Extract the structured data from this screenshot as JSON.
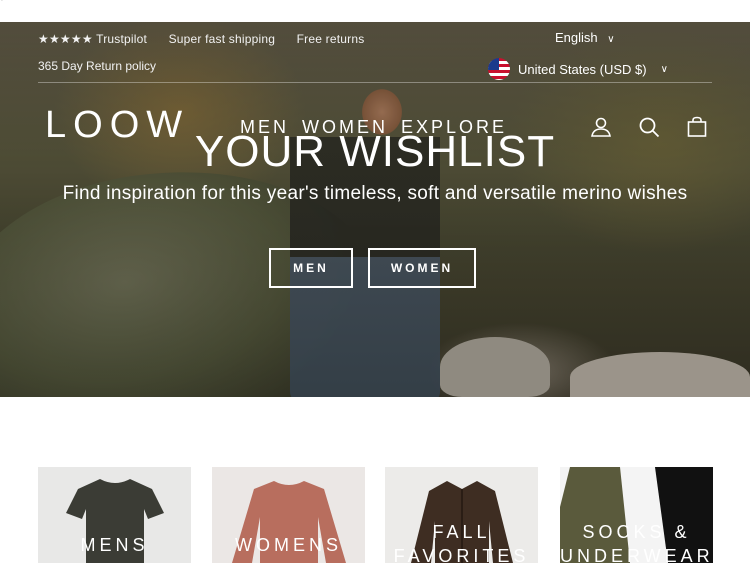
{
  "stray_mark": "'",
  "announcement": {
    "rating": "★★★★★ Trustpilot",
    "shipping": "Super fast shipping",
    "returns": "Free returns",
    "return_policy": "365 Day Return policy"
  },
  "locale": {
    "language": "English",
    "country": "United States (USD $)"
  },
  "header": {
    "logo": "LOOW",
    "nav": [
      "MEN",
      "WOMEN",
      "EXPLORE"
    ]
  },
  "icons": [
    "account-icon",
    "search-icon",
    "bag-icon"
  ],
  "hero": {
    "title": "YOUR WISHLIST",
    "subtitle": "Find inspiration for this year's timeless, soft and versatile merino wishes",
    "buttons": [
      "MEN",
      "WOMEN"
    ]
  },
  "categories": [
    {
      "label": "MENS"
    },
    {
      "label": "WOMENS"
    },
    {
      "label": "FALL FAVORITES"
    },
    {
      "label": "SOCKS & UNDERWEAR"
    }
  ],
  "colors": {
    "text_on_image": "#ffffff",
    "flag_red": "#c8102e",
    "flag_blue": "#1b3a8c"
  }
}
